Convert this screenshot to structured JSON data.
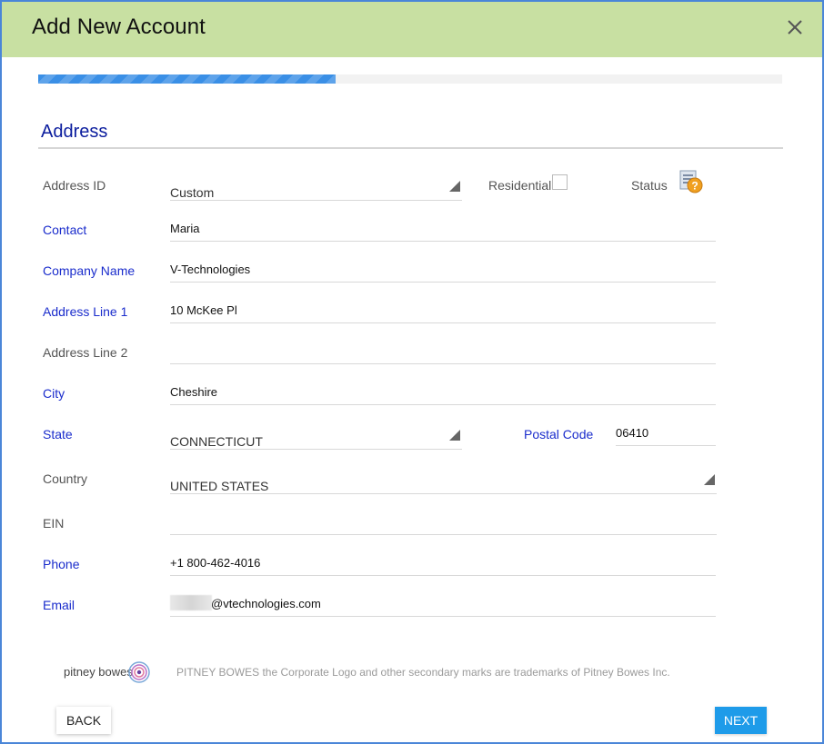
{
  "dialog": {
    "title": "Add New Account",
    "close_icon": "close-icon"
  },
  "progress": {
    "fraction": 0.4
  },
  "section": {
    "title": "Address"
  },
  "fields": {
    "address_id": {
      "label": "Address ID",
      "value": "Custom"
    },
    "residential": {
      "label": "Residential",
      "checked": false
    },
    "status": {
      "label": "Status",
      "icon": "status-help-icon"
    },
    "contact": {
      "label": "Contact",
      "value": "Maria"
    },
    "company_name": {
      "label": "Company Name",
      "value": "V-Technologies"
    },
    "address_line_1": {
      "label": "Address Line 1",
      "value": "10 McKee Pl"
    },
    "address_line_2": {
      "label": "Address Line 2",
      "value": ""
    },
    "city": {
      "label": "City",
      "value": "Cheshire"
    },
    "state": {
      "label": "State",
      "value": "CONNECTICUT"
    },
    "postal_code": {
      "label": "Postal Code",
      "value": "06410"
    },
    "country": {
      "label": "Country",
      "value": "UNITED STATES"
    },
    "ein": {
      "label": "EIN",
      "value": ""
    },
    "phone": {
      "label": "Phone",
      "value": "+1 800-462-4016"
    },
    "email": {
      "label": "Email",
      "value": "@vtechnologies.com"
    }
  },
  "footer": {
    "logo_text": "pitney bowes",
    "trademark": "PITNEY BOWES the Corporate Logo and other secondary marks are trademarks of Pitney Bowes Inc."
  },
  "buttons": {
    "back": "BACK",
    "next": "NEXT"
  },
  "colors": {
    "title_bar": "#c8e0a2",
    "progress": "#3a8fe6",
    "required_label": "#1a2ccc",
    "next_button": "#1e9be9",
    "frame_border": "#4a86d8"
  }
}
